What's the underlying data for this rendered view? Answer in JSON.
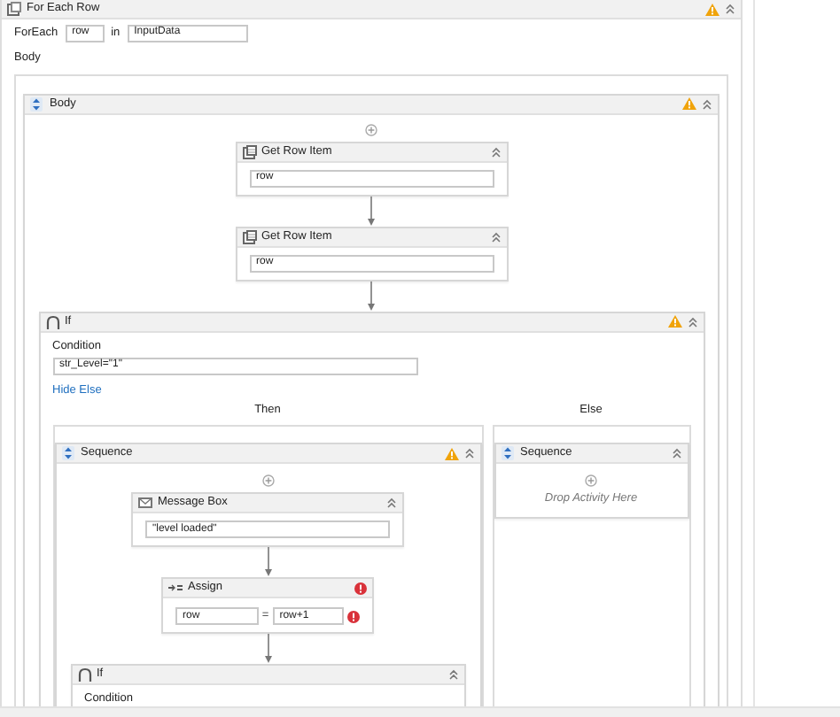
{
  "activity": {
    "title": "For Each Row",
    "warning": true,
    "foreach_label": "ForEach",
    "item_var": "row",
    "in_label": "in",
    "collection": "InputData",
    "body_label": "Body",
    "body": {
      "title": "Body",
      "warning": true,
      "activities": [
        {
          "kind": "get-row-item",
          "title": "Get Row Item",
          "value": "row"
        },
        {
          "kind": "get-row-item",
          "title": "Get Row Item",
          "value": "row"
        },
        {
          "kind": "if",
          "title": "If",
          "warning": true,
          "condition_label": "Condition",
          "condition": "str_Level=\"1\"",
          "hide_else": "Hide Else",
          "then_label": "Then",
          "else_label": "Else",
          "then": {
            "title": "Sequence",
            "warning": true,
            "activities": [
              {
                "kind": "message-box",
                "title": "Message Box",
                "value": "\"level loaded\""
              },
              {
                "kind": "assign",
                "title": "Assign",
                "error": true,
                "to": "row",
                "equals": "=",
                "value": "row+1",
                "value_error": true
              },
              {
                "kind": "if",
                "title": "If",
                "warning": false,
                "condition_label": "Condition"
              }
            ]
          },
          "else": {
            "title": "Sequence",
            "warning": false,
            "placeholder": "Drop Activity Here"
          }
        }
      ]
    }
  }
}
